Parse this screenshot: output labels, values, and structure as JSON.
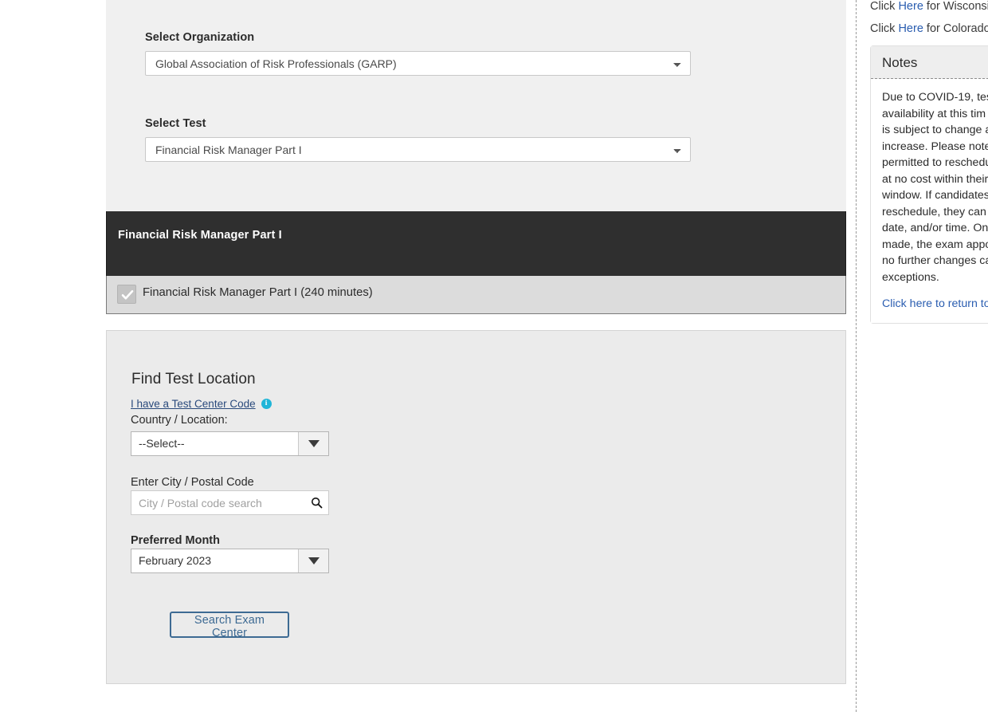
{
  "form": {
    "organization": {
      "label": "Select Organization",
      "selected": "Global Association of Risk Professionals (GARP)",
      "options": [
        "Global Association of Risk Professionals (GARP)"
      ]
    },
    "test": {
      "label": "Select Test",
      "selected": "Financial Risk Manager Part I",
      "options": [
        "Financial Risk Manager Part I"
      ]
    }
  },
  "exam_banner": {
    "title": "Financial Risk Manager Part I"
  },
  "exam_row": {
    "label": "Financial Risk Manager Part I (240 minutes)",
    "checked": true
  },
  "find_location": {
    "title": "Find Test Location",
    "test_center_code_link": "I have a Test Center Code",
    "info_icon_glyph": "i",
    "country_label": "Country / Location:",
    "country_value": "--Select--",
    "city_label": "Enter City / Postal Code",
    "city_placeholder": "City / Postal code search",
    "city_value": "",
    "month_label": "Preferred Month",
    "month_value": "February 2023",
    "search_button": "Search Exam Center"
  },
  "sidebar": {
    "links": [
      {
        "prefix": "Click ",
        "link": "Here",
        "suffix": " for Wisconsi"
      },
      {
        "prefix": "Click ",
        "link": "Here",
        "suffix": " for Colorado"
      }
    ],
    "notes": {
      "header": "Notes",
      "body": "Due to COVID-19, tes\navailability at this tim\nis subject to change a\nincrease. Please note:\npermitted to reschedu\nat no cost within their\nwindow. If candidates\nreschedule, they can \ndate, and/or time. On\nmade, the exam appo\nno further changes ca\nexceptions.",
      "return_link": "Click here to return to"
    }
  },
  "colors": {
    "banner_bg": "#2f2f2f",
    "panel_bg": "#ebebeb",
    "section_bg": "#f0f0f0",
    "row_bg": "#dcdcdc",
    "accent_link": "#2a5db0",
    "button_border": "#3d6a93",
    "info_icon": "#1fb5d8"
  }
}
